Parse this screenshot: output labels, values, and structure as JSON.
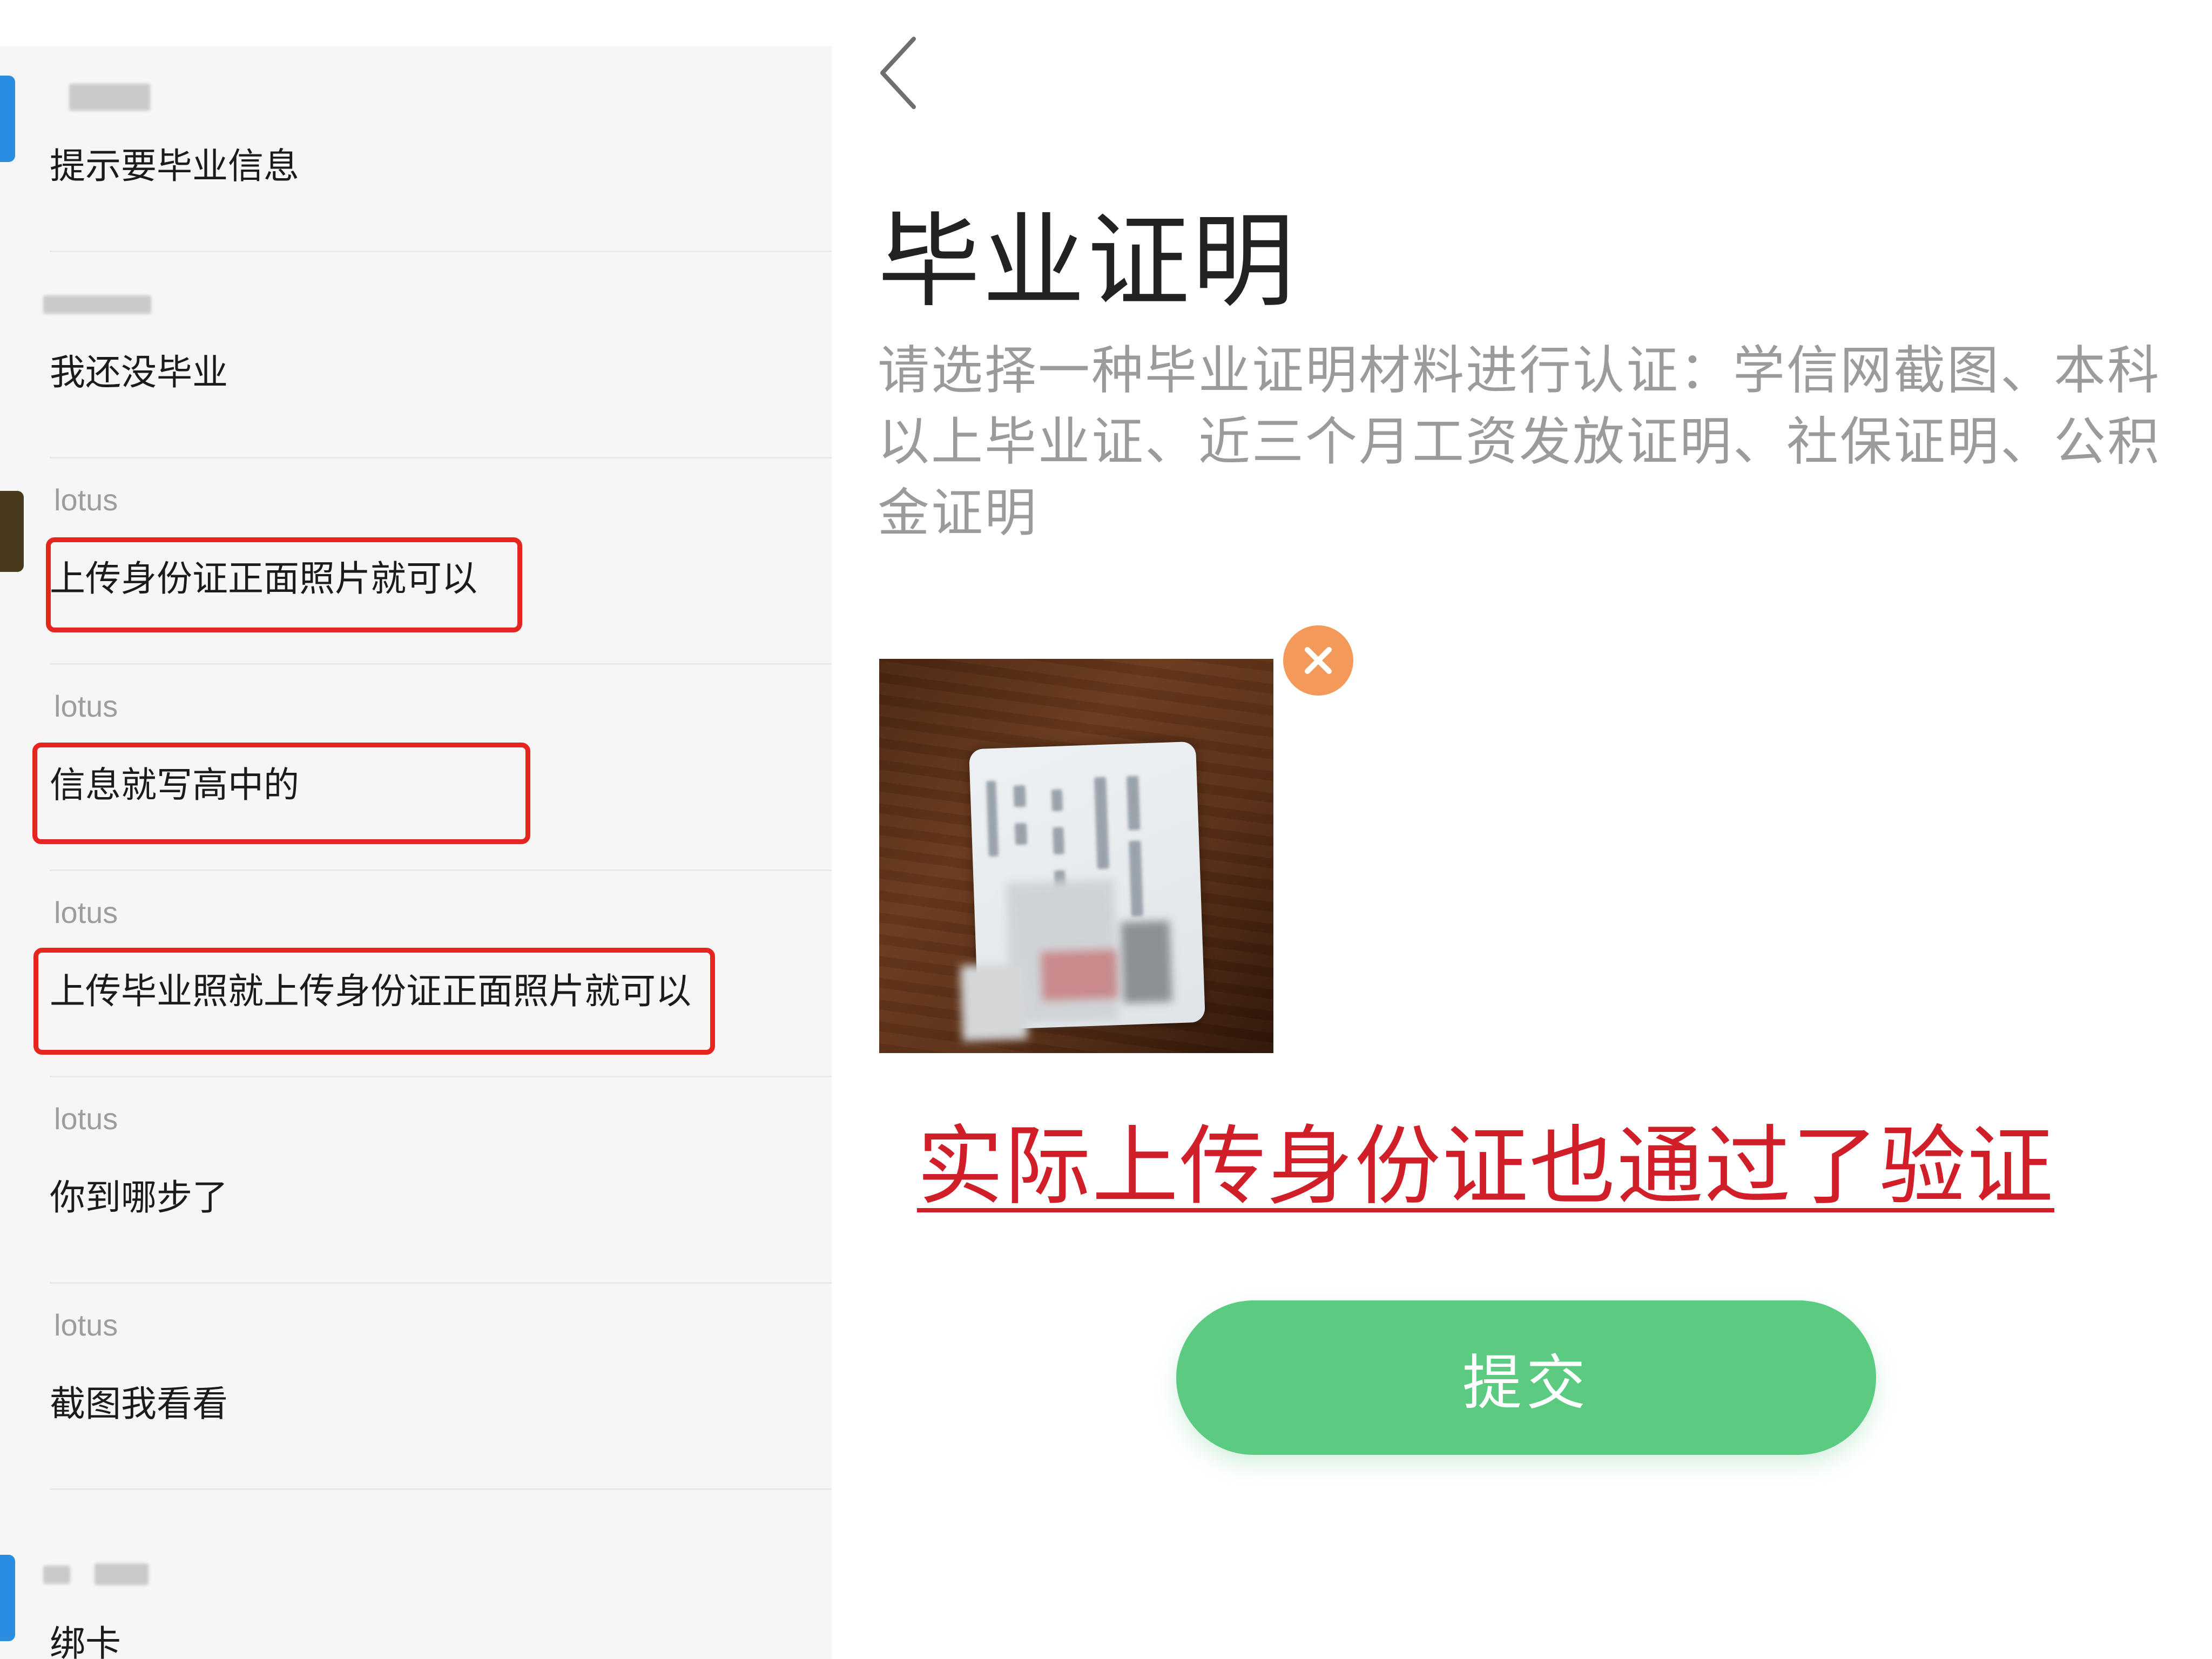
{
  "chat": {
    "messages": [
      {
        "sender": "",
        "text": "提示要毕业信息",
        "avatar_color": "#2a8ee0",
        "highlighted": false
      },
      {
        "sender": "",
        "text": "我还没毕业",
        "avatar_color": "",
        "highlighted": false
      },
      {
        "sender": "lotus",
        "text": "上传身份证正面照片就可以",
        "avatar_color": "#4a3a1c",
        "highlighted": true
      },
      {
        "sender": "lotus",
        "text": "信息就写高中的",
        "avatar_color": "",
        "highlighted": true
      },
      {
        "sender": "lotus",
        "text": "上传毕业照就上传身份证正面照片就可以",
        "avatar_color": "",
        "highlighted": true
      },
      {
        "sender": "lotus",
        "text": "你到哪步了",
        "avatar_color": "",
        "highlighted": false
      },
      {
        "sender": "lotus",
        "text": "截图我看看",
        "avatar_color": "",
        "highlighted": false
      },
      {
        "sender": "",
        "text": "绑卡",
        "avatar_color": "#2a8ee0",
        "highlighted": false
      }
    ],
    "highlight_color": "#e5261f"
  },
  "page": {
    "back_icon": "chevron-left-icon",
    "title": "毕业证明",
    "description": "请选择一种毕业证明材料进行认证：学信网截图、本科以上毕业证、近三个月工资发放证明、社保证明、公积金证明",
    "remove_icon": "close-icon",
    "remove_color": "#f39a5a",
    "annotation": "实际上传身份证也通过了验证",
    "annotation_color": "#d11f2a",
    "submit_label": "提交",
    "submit_color": "#5ccb82"
  }
}
